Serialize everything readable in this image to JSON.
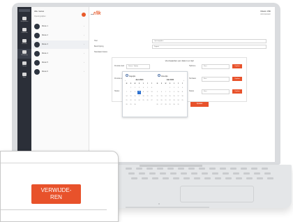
{
  "rail": {
    "items": [
      {
        "label": "Gesprekken",
        "icon": "chat-icon"
      },
      {
        "label": "Contacten",
        "icon": "contacts-icon"
      },
      {
        "label": "Kanalen",
        "icon": "channel-icon"
      },
      {
        "label": "Routering",
        "icon": "routing-icon"
      },
      {
        "label": "Teams",
        "icon": "team-icon"
      },
      {
        "label": "Meer",
        "icon": "more-icon"
      }
    ]
  },
  "list": {
    "header": "Alle routes",
    "filter": "Openingstijden",
    "items": [
      {
        "label": "Route 1"
      },
      {
        "label": "Route 2"
      },
      {
        "label": "Route 3"
      },
      {
        "label": "Route 4"
      },
      {
        "label": "Route 5"
      },
      {
        "label": "Route 6"
      }
    ]
  },
  "main": {
    "logo": "r/lk",
    "user_name": "Maxim Wilt",
    "user_sub": "Administrator",
    "fields": [
      {
        "label": "Titel",
        "value": "Openingstijden"
      },
      {
        "label": "Beschrijving",
        "value": "Support"
      },
      {
        "label": "Standaard status",
        "value": ""
      }
    ],
    "section_title": "Voorwaarden per datum en tijd",
    "rows": [
      {
        "label": "Periode start",
        "select": "Datum - Tijdstip",
        "right_label": "Tijdzone",
        "right_select": "Kies...",
        "button": "Opslaan"
      },
      {
        "label": "Periode eind",
        "select": "",
        "right_label": "Herhalen",
        "right_select": "Kies...",
        "button": "Opslaan"
      },
      {
        "label": "Status",
        "select": "",
        "right_label": "Status",
        "right_select": "Kies...",
        "button": "Opslaan"
      }
    ],
    "save_button": "Opslaan",
    "datepicker": {
      "radio_a": "Dagelijks",
      "radio_b": "Wekelijks",
      "month_left": "Juni 2021",
      "month_right": "Juli 2021",
      "weekdays": [
        "M",
        "D",
        "W",
        "D",
        "V",
        "Z",
        "Z"
      ],
      "selected_day": "10"
    }
  },
  "callout": {
    "delete_button": "VERWIJDE-\nREN"
  },
  "colors": {
    "accent": "#e8522b",
    "rail": "#2b2f38",
    "select": "#2a6fcf"
  }
}
